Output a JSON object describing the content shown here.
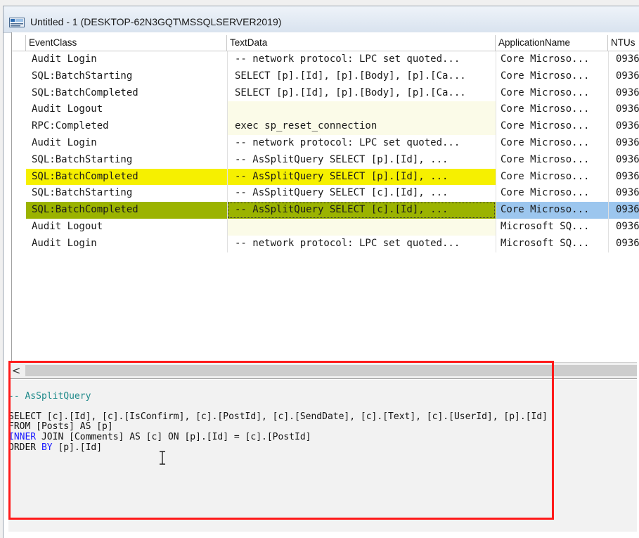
{
  "window": {
    "title": "Untitled - 1 (DESKTOP-62N3GQT\\MSSQLSERVER2019)",
    "icon": "profiler-trace-icon"
  },
  "grid": {
    "columns": [
      "EventClass",
      "TextData",
      "ApplicationName",
      "NTUs"
    ],
    "rows": [
      {
        "event": "Audit Login",
        "text": "-- network protocol: LPC  set quoted...",
        "app": "Core Microso...",
        "nt": "0936",
        "style": ""
      },
      {
        "event": "SQL:BatchStarting",
        "text": "SELECT [p].[Id], [p].[Body], [p].[Ca...",
        "app": "Core Microso...",
        "nt": "0936",
        "style": ""
      },
      {
        "event": "SQL:BatchCompleted",
        "text": "SELECT [p].[Id], [p].[Body], [p].[Ca...",
        "app": "Core Microso...",
        "nt": "0936",
        "style": ""
      },
      {
        "event": "Audit Logout",
        "text": "",
        "app": "Core Microso...",
        "nt": "0936",
        "style": "cream"
      },
      {
        "event": "RPC:Completed",
        "text": "exec sp_reset_connection",
        "app": "Core Microso...",
        "nt": "0936",
        "style": "cream"
      },
      {
        "event": "Audit Login",
        "text": "-- network protocol: LPC  set quoted...",
        "app": "Core Microso...",
        "nt": "0936",
        "style": ""
      },
      {
        "event": "SQL:BatchStarting",
        "text": "-- AsSplitQuery    SELECT [p].[Id], ...",
        "app": "Core Microso...",
        "nt": "0936",
        "style": ""
      },
      {
        "event": "SQL:BatchCompleted",
        "text": "-- AsSplitQuery    SELECT [p].[Id], ...",
        "app": "Core Microso...",
        "nt": "0936",
        "style": "yellow"
      },
      {
        "event": "SQL:BatchStarting",
        "text": "-- AsSplitQuery    SELECT [c].[Id], ...",
        "app": "Core Microso...",
        "nt": "0936",
        "style": ""
      },
      {
        "event": "SQL:BatchCompleted",
        "text": "-- AsSplitQuery    SELECT [c].[Id], ...",
        "app": "Core Microso...",
        "nt": "0936",
        "style": "selected"
      },
      {
        "event": "Audit Logout",
        "text": "",
        "app": "Microsoft SQ...",
        "nt": "0936",
        "style": "cream"
      },
      {
        "event": "Audit Login",
        "text": "-- network protocol: LPC  set quoted...",
        "app": "Microsoft SQ...",
        "nt": "0936",
        "style": ""
      }
    ]
  },
  "scrollbar": {
    "left_arrow": "<"
  },
  "sql_text": {
    "comment": "-- AsSplitQuery",
    "line1": "SELECT [c].[Id], [c].[IsConfirm], [c].[PostId], [c].[SendDate], [c].[Text], [c].[UserId], [p].[Id]",
    "line2": "FROM [Posts] AS [p]",
    "line3_kw": "INNER",
    "line3_rest": " JOIN [Comments] AS [c] ON [p].[Id] = [c].[PostId]",
    "line4_a": "ORDER ",
    "line4_kw": "BY",
    "line4_rest": " [p].[Id]"
  },
  "colors": {
    "highlight_yellow": "#f6f000",
    "highlight_olive": "#9bb300",
    "selection_blue": "#9cc6ee",
    "annotation_red": "#ff1a1a",
    "keyword_blue": "#1a1aff",
    "comment_teal": "#1f8a8a"
  }
}
